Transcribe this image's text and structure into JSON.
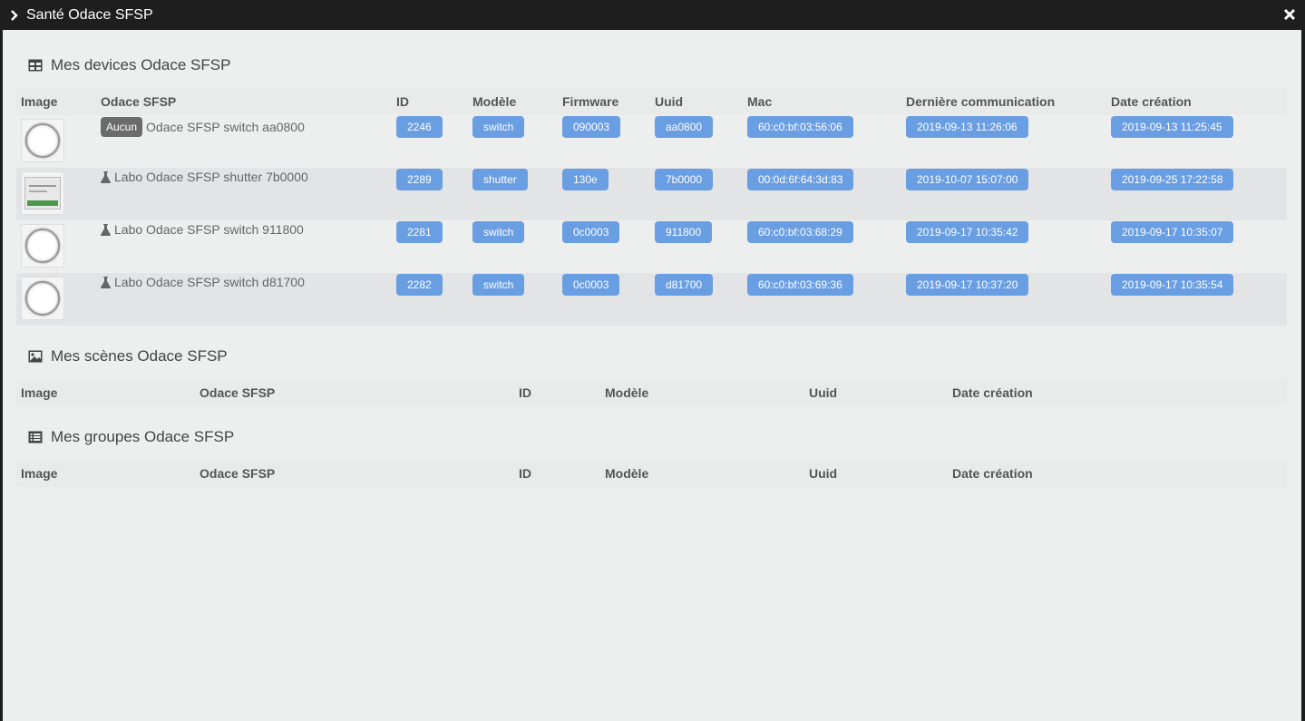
{
  "modal": {
    "title": "Santé Odace SFSP",
    "chevron_icon": "chevron-right-icon",
    "close_icon": "close-icon"
  },
  "devices_section": {
    "title": "Mes devices Odace SFSP",
    "icon": "table-icon",
    "columns": [
      "Image",
      "Odace SFSP",
      "ID",
      "Modèle",
      "Firmware",
      "Uuid",
      "Mac",
      "Dernière communication",
      "Date création"
    ],
    "rows": [
      {
        "image": "switch",
        "tag": "Aucun",
        "tag_icon": "",
        "name": "Odace SFSP switch aa0800",
        "id": "2246",
        "model": "switch",
        "firmware": "090003",
        "uuid": "aa0800",
        "mac": "60:c0:bf:03:56:06",
        "last_comm": "2019-09-13 11:26:06",
        "created": "2019-09-13 11:25:45"
      },
      {
        "image": "shutter",
        "tag": "",
        "tag_icon": "flask-icon",
        "name": "Labo Odace SFSP shutter 7b0000",
        "id": "2289",
        "model": "shutter",
        "firmware": "130e",
        "uuid": "7b0000",
        "mac": "00:0d:6f:64:3d:83",
        "last_comm": "2019-10-07 15:07:00",
        "created": "2019-09-25 17:22:58"
      },
      {
        "image": "switch",
        "tag": "",
        "tag_icon": "flask-icon",
        "name": "Labo Odace SFSP switch 911800",
        "id": "2281",
        "model": "switch",
        "firmware": "0c0003",
        "uuid": "911800",
        "mac": "60:c0:bf:03:68:29",
        "last_comm": "2019-09-17 10:35:42",
        "created": "2019-09-17 10:35:07"
      },
      {
        "image": "switch",
        "tag": "",
        "tag_icon": "flask-icon",
        "name": "Labo Odace SFSP switch d81700",
        "id": "2282",
        "model": "switch",
        "firmware": "0c0003",
        "uuid": "d81700",
        "mac": "60:c0:bf:03:69:36",
        "last_comm": "2019-09-17 10:37:20",
        "created": "2019-09-17 10:35:54"
      }
    ]
  },
  "scenes_section": {
    "title": "Mes scènes Odace SFSP",
    "icon": "image-icon",
    "columns": [
      "Image",
      "Odace SFSP",
      "ID",
      "Modèle",
      "Uuid",
      "Date création"
    ]
  },
  "groups_section": {
    "title": "Mes groupes Odace SFSP",
    "icon": "list-icon",
    "columns": [
      "Image",
      "Odace SFSP",
      "ID",
      "Modèle",
      "Uuid",
      "Date création"
    ]
  },
  "colors": {
    "badge": "#6a9ee3",
    "tag": "#6b6b6b",
    "titlebar": "#1e1e1e"
  }
}
